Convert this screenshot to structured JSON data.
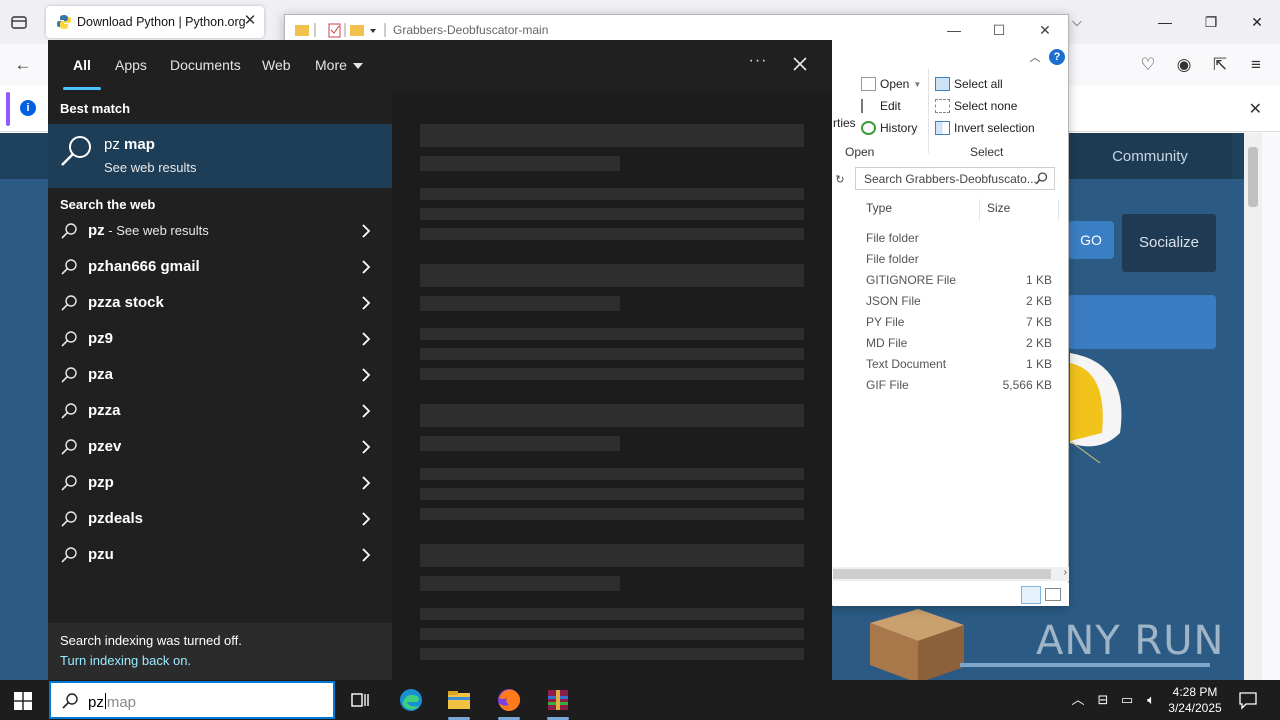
{
  "browser": {
    "tab_title": "Download Python | Python.org"
  },
  "webpage": {
    "nav_community": "Community",
    "go_label": "GO",
    "socialize_label": "Socialize"
  },
  "watermark": {
    "text": "ANY RUN"
  },
  "explorer": {
    "title": "Grabbers-Deobfuscator-main",
    "ribbon": {
      "properties_partial": "rties",
      "open": "Open",
      "edit": "Edit",
      "history": "History",
      "open_group": "Open",
      "select_all": "Select all",
      "select_none": "Select none",
      "invert_selection": "Invert selection",
      "select_group": "Select"
    },
    "search_placeholder": "Search Grabbers-Deobfuscato...",
    "columns": {
      "type": "Type",
      "size": "Size"
    },
    "rows": [
      {
        "type": "File folder",
        "size": ""
      },
      {
        "type": "File folder",
        "size": ""
      },
      {
        "type": "GITIGNORE File",
        "size": "1 KB"
      },
      {
        "type": "JSON File",
        "size": "2 KB"
      },
      {
        "type": "PY File",
        "size": "7 KB"
      },
      {
        "type": "MD File",
        "size": "2 KB"
      },
      {
        "type": "Text Document",
        "size": "1 KB"
      },
      {
        "type": "GIF File",
        "size": "5,566 KB"
      }
    ]
  },
  "search": {
    "tabs": [
      "All",
      "Apps",
      "Documents",
      "Web",
      "More"
    ],
    "best_match_label": "Best match",
    "best_match": {
      "prefix": "pz",
      "rest": " map",
      "subtitle": "See web results"
    },
    "search_web_label": "Search the web",
    "web_results": [
      {
        "bold": "pz",
        "suffix": " - See web results"
      },
      {
        "bold": "pzhan666 gmail",
        "suffix": ""
      },
      {
        "bold": "pzza stock",
        "suffix": ""
      },
      {
        "bold": "pz9",
        "suffix": ""
      },
      {
        "bold": "pza",
        "suffix": ""
      },
      {
        "bold": "pzza",
        "suffix": ""
      },
      {
        "bold": "pzev",
        "suffix": ""
      },
      {
        "bold": "pzp",
        "suffix": ""
      },
      {
        "bold": "pzdeals",
        "suffix": ""
      },
      {
        "bold": "pzu",
        "suffix": ""
      }
    ],
    "indexing_notice": "Search indexing was turned off.",
    "indexing_link": "Turn indexing back on."
  },
  "taskbar": {
    "query_typed": "pz",
    "query_suggestion": "map",
    "time": "4:28 PM",
    "date": "3/24/2025"
  },
  "colors": {
    "accent": "#4cc2ff",
    "best_match_bg": "#1e3e57",
    "panel_bg": "#202020",
    "python_blue": "#2b5b84"
  }
}
